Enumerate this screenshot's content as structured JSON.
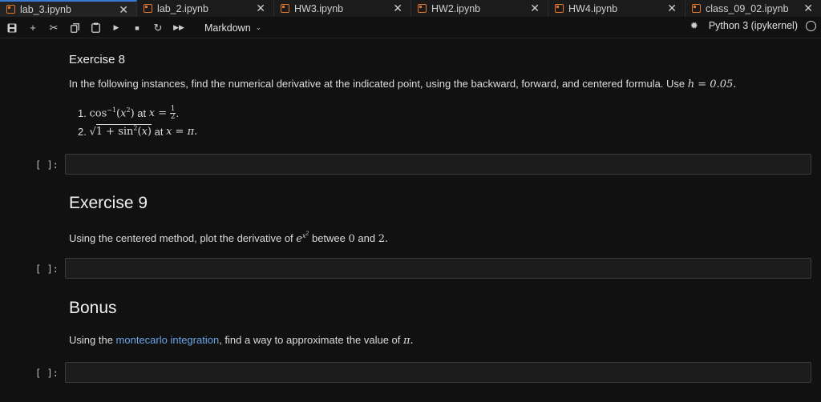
{
  "tabs": [
    {
      "label": "lab_3.ipynb",
      "active": true
    },
    {
      "label": "lab_2.ipynb",
      "active": false
    },
    {
      "label": "HW3.ipynb",
      "active": false
    },
    {
      "label": "HW2.ipynb",
      "active": false
    },
    {
      "label": "HW4.ipynb",
      "active": false
    },
    {
      "label": "class_09_02.ipynb",
      "active": false
    }
  ],
  "toolbar": {
    "icons": [
      "save-icon",
      "plus-icon",
      "scissors-icon",
      "copy-icon",
      "paste-icon",
      "run-icon",
      "stop-icon",
      "restart-icon",
      "fast-forward-icon"
    ],
    "cell_type": "Markdown",
    "kernel": "Python 3 (ipykernel)"
  },
  "colors": {
    "accent": "#3b7bd6",
    "notebook_icon": "#e2772a",
    "link": "#6aa6e8"
  },
  "exercise8": {
    "title": "Exercise 8",
    "intro": "In the following instances, find the numerical derivative at the indicated point, using the backward, forward, and centered formula. Use",
    "h_value": "h = 0.05.",
    "item1_num": "1.",
    "item1_at": "at",
    "item1_x": "x =",
    "item2_num": "2.",
    "item2_at": "at",
    "item2_x": "x = π."
  },
  "exercise9": {
    "title": "Exercise 9",
    "text_before": "Using the centered method, plot the derivative of",
    "text_mid": "betwee",
    "zero": "0",
    "and": "and",
    "two": "2."
  },
  "bonus": {
    "title": "Bonus",
    "text_before": "Using the",
    "link": "montecarlo integration",
    "text_after": ", find a way to approximate the value of",
    "pi": "π."
  },
  "prompts": [
    "[ ]:",
    "[ ]:",
    "[ ]:"
  ]
}
